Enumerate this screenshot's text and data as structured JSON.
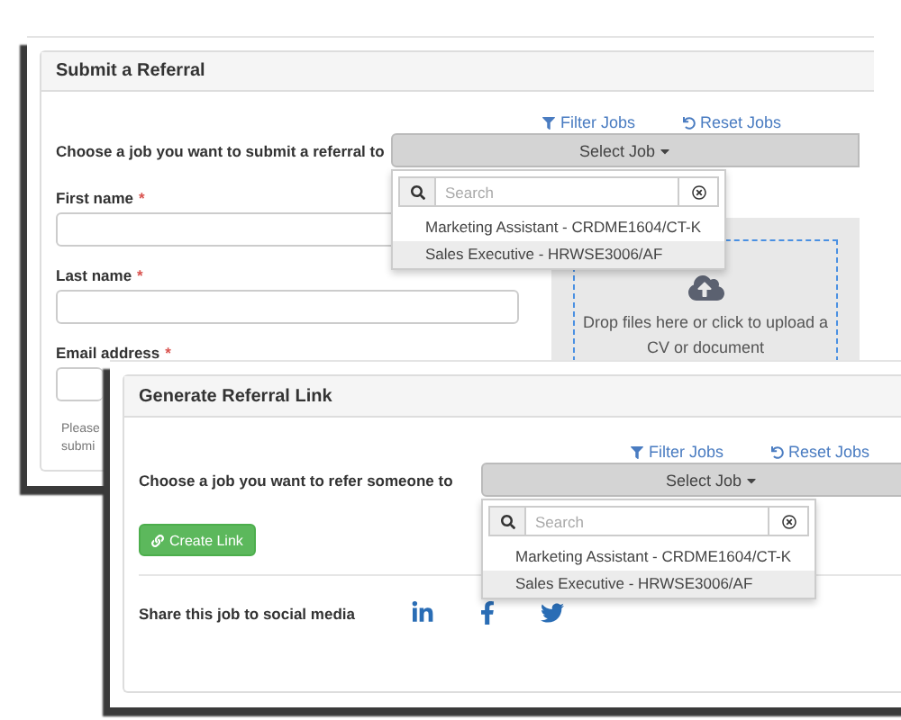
{
  "referral_window": {
    "title": "Submit a Referral",
    "filter_link": "Filter Jobs",
    "reset_link": "Reset Jobs",
    "job_label": "Choose a job you want to submit a referral to",
    "select_button": "Select Job",
    "dropdown": {
      "placeholder": "Search",
      "items": [
        {
          "label": "Marketing Assistant - CRDME1604/CT-K",
          "selected": false
        },
        {
          "label": "Sales Executive - HRWSE3006/AF",
          "selected": true
        }
      ]
    },
    "fields": [
      {
        "label": "First name",
        "required": "*"
      },
      {
        "label": "Last name",
        "required": "*"
      },
      {
        "label": "Email address",
        "required": "*"
      }
    ],
    "note_lines": [
      "Please",
      "submi"
    ],
    "dropzone": {
      "text": "Drop files here or click to upload a CV or document"
    }
  },
  "link_window": {
    "title": "Generate Referral Link",
    "filter_link": "Filter Jobs",
    "reset_link": "Reset Jobs",
    "job_label": "Choose a job you want to refer someone to",
    "select_button": "Select Job",
    "dropdown": {
      "placeholder": "Search",
      "items": [
        {
          "label": "Marketing Assistant - CRDME1604/CT-K",
          "selected": false
        },
        {
          "label": "Sales Executive - HRWSE3006/AF",
          "selected": true
        }
      ]
    },
    "create_button": "Create Link",
    "share_label": "Share this job to social media",
    "social": [
      {
        "kind": "linkedin"
      },
      {
        "kind": "facebook"
      },
      {
        "kind": "twitter"
      }
    ]
  }
}
